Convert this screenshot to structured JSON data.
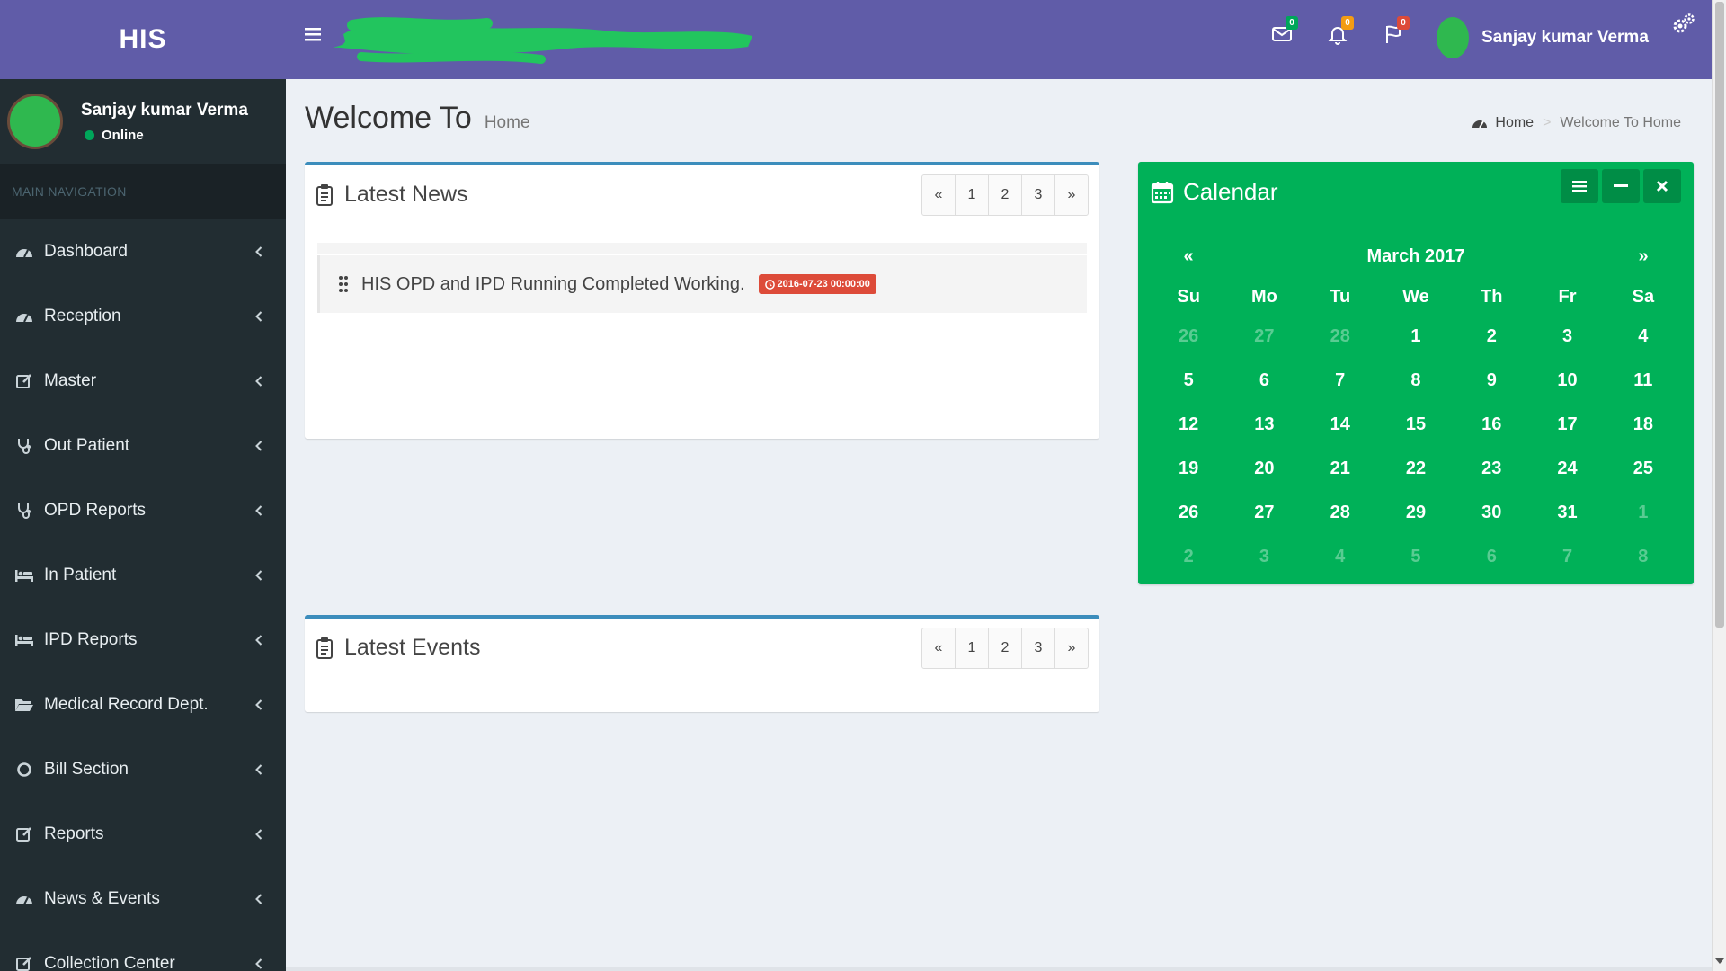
{
  "app": {
    "logo": "HIS"
  },
  "user": {
    "name": "Sanjay kumar Verma",
    "status": "Online"
  },
  "sidebar": {
    "header": "MAIN NAVIGATION",
    "items": [
      {
        "label": "Dashboard",
        "icon": "dashboard-icon"
      },
      {
        "label": "Reception",
        "icon": "dashboard-icon"
      },
      {
        "label": "Master",
        "icon": "edit-icon"
      },
      {
        "label": "Out Patient",
        "icon": "stethoscope-icon"
      },
      {
        "label": "OPD Reports",
        "icon": "stethoscope-icon"
      },
      {
        "label": "In Patient",
        "icon": "bed-icon"
      },
      {
        "label": "IPD Reports",
        "icon": "bed-icon"
      },
      {
        "label": "Medical Record Dept.",
        "icon": "folder-open-icon"
      },
      {
        "label": "Bill Section",
        "icon": "circle-icon"
      },
      {
        "label": "Reports",
        "icon": "edit-icon"
      },
      {
        "label": "News & Events",
        "icon": "dashboard-icon"
      },
      {
        "label": "Collection Center",
        "icon": "edit-icon"
      }
    ]
  },
  "topbar": {
    "messages_count": "0",
    "notifications_count": "0",
    "tasks_count": "0",
    "colors": {
      "messages_badge": "#00a65a",
      "notifications_badge": "#f39c12",
      "tasks_badge": "#dd4b39"
    }
  },
  "page": {
    "title": "Welcome To",
    "subtitle": "Home"
  },
  "breadcrumb": {
    "home": "Home",
    "separator": ">",
    "current": "Welcome To Home"
  },
  "news": {
    "title": "Latest News",
    "pager": [
      "«",
      "1",
      "2",
      "3",
      "»"
    ],
    "items": [
      {
        "text": "HIS OPD and IPD Running Completed Working.",
        "date": "2016-07-23 00:00:00"
      }
    ]
  },
  "events": {
    "title": "Latest Events",
    "pager": [
      "«",
      "1",
      "2",
      "3",
      "»"
    ]
  },
  "calendar": {
    "title": "Calendar",
    "month": "March 2017",
    "prev": "«",
    "next": "»",
    "weekdays": [
      "Su",
      "Mo",
      "Tu",
      "We",
      "Th",
      "Fr",
      "Sa"
    ],
    "weeks": [
      [
        {
          "d": "26",
          "m": true
        },
        {
          "d": "27",
          "m": true
        },
        {
          "d": "28",
          "m": true
        },
        {
          "d": "1"
        },
        {
          "d": "2"
        },
        {
          "d": "3"
        },
        {
          "d": "4"
        }
      ],
      [
        {
          "d": "5"
        },
        {
          "d": "6"
        },
        {
          "d": "7"
        },
        {
          "d": "8"
        },
        {
          "d": "9"
        },
        {
          "d": "10"
        },
        {
          "d": "11"
        }
      ],
      [
        {
          "d": "12"
        },
        {
          "d": "13"
        },
        {
          "d": "14"
        },
        {
          "d": "15"
        },
        {
          "d": "16"
        },
        {
          "d": "17"
        },
        {
          "d": "18"
        }
      ],
      [
        {
          "d": "19"
        },
        {
          "d": "20"
        },
        {
          "d": "21"
        },
        {
          "d": "22"
        },
        {
          "d": "23"
        },
        {
          "d": "24"
        },
        {
          "d": "25"
        }
      ],
      [
        {
          "d": "26"
        },
        {
          "d": "27"
        },
        {
          "d": "28"
        },
        {
          "d": "29"
        },
        {
          "d": "30"
        },
        {
          "d": "31"
        },
        {
          "d": "1",
          "m": true
        }
      ],
      [
        {
          "d": "2",
          "m": true
        },
        {
          "d": "3",
          "m": true
        },
        {
          "d": "4",
          "m": true
        },
        {
          "d": "5",
          "m": true
        },
        {
          "d": "6",
          "m": true
        },
        {
          "d": "7",
          "m": true
        },
        {
          "d": "8",
          "m": true
        }
      ]
    ],
    "accent": "#00b158"
  },
  "colors": {
    "header": "#605ca8",
    "sidebar": "#222d32",
    "box_border": "#3c8dbc"
  }
}
